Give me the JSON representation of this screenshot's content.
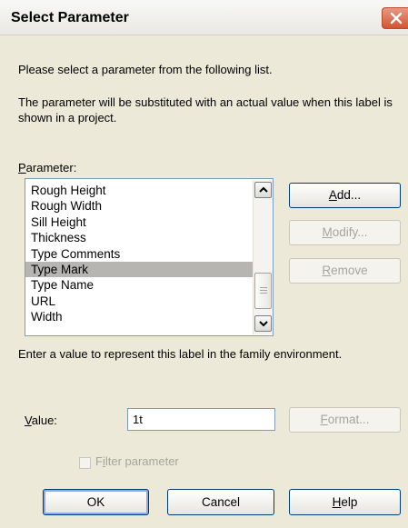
{
  "window": {
    "title": "Select Parameter"
  },
  "description": {
    "line1": "Please select a parameter from the following list.",
    "line2": "The parameter will be substituted with an actual value when this label is shown in a project."
  },
  "parameter_section": {
    "label_prefix": "",
    "label_mnemonic": "P",
    "label_rest": "arameter:",
    "items": [
      "Rough Height",
      "Rough Width",
      "Sill Height",
      "Thickness",
      "Type Comments",
      "Type Mark",
      "Type Name",
      "URL",
      "Width"
    ],
    "selected": "Type Mark"
  },
  "buttons": {
    "add": "Add...",
    "modify": "Modify...",
    "remove": "Remove",
    "format": "Format...",
    "ok": "OK",
    "cancel": "Cancel",
    "help": "Help"
  },
  "value_section": {
    "help_text": "Enter a value to represent this label in the family environment.",
    "label": "Value:",
    "value": "1t"
  },
  "filter": {
    "label": "Filter parameter",
    "checked": false,
    "enabled": false
  },
  "icons": {
    "close": "close-icon",
    "scroll_up": "chevron-up-icon",
    "scroll_down": "chevron-down-icon"
  },
  "colors": {
    "selection": "#b6b5b2",
    "dialog_bg": "#ece9d8",
    "close_btn": "#d3542f"
  }
}
